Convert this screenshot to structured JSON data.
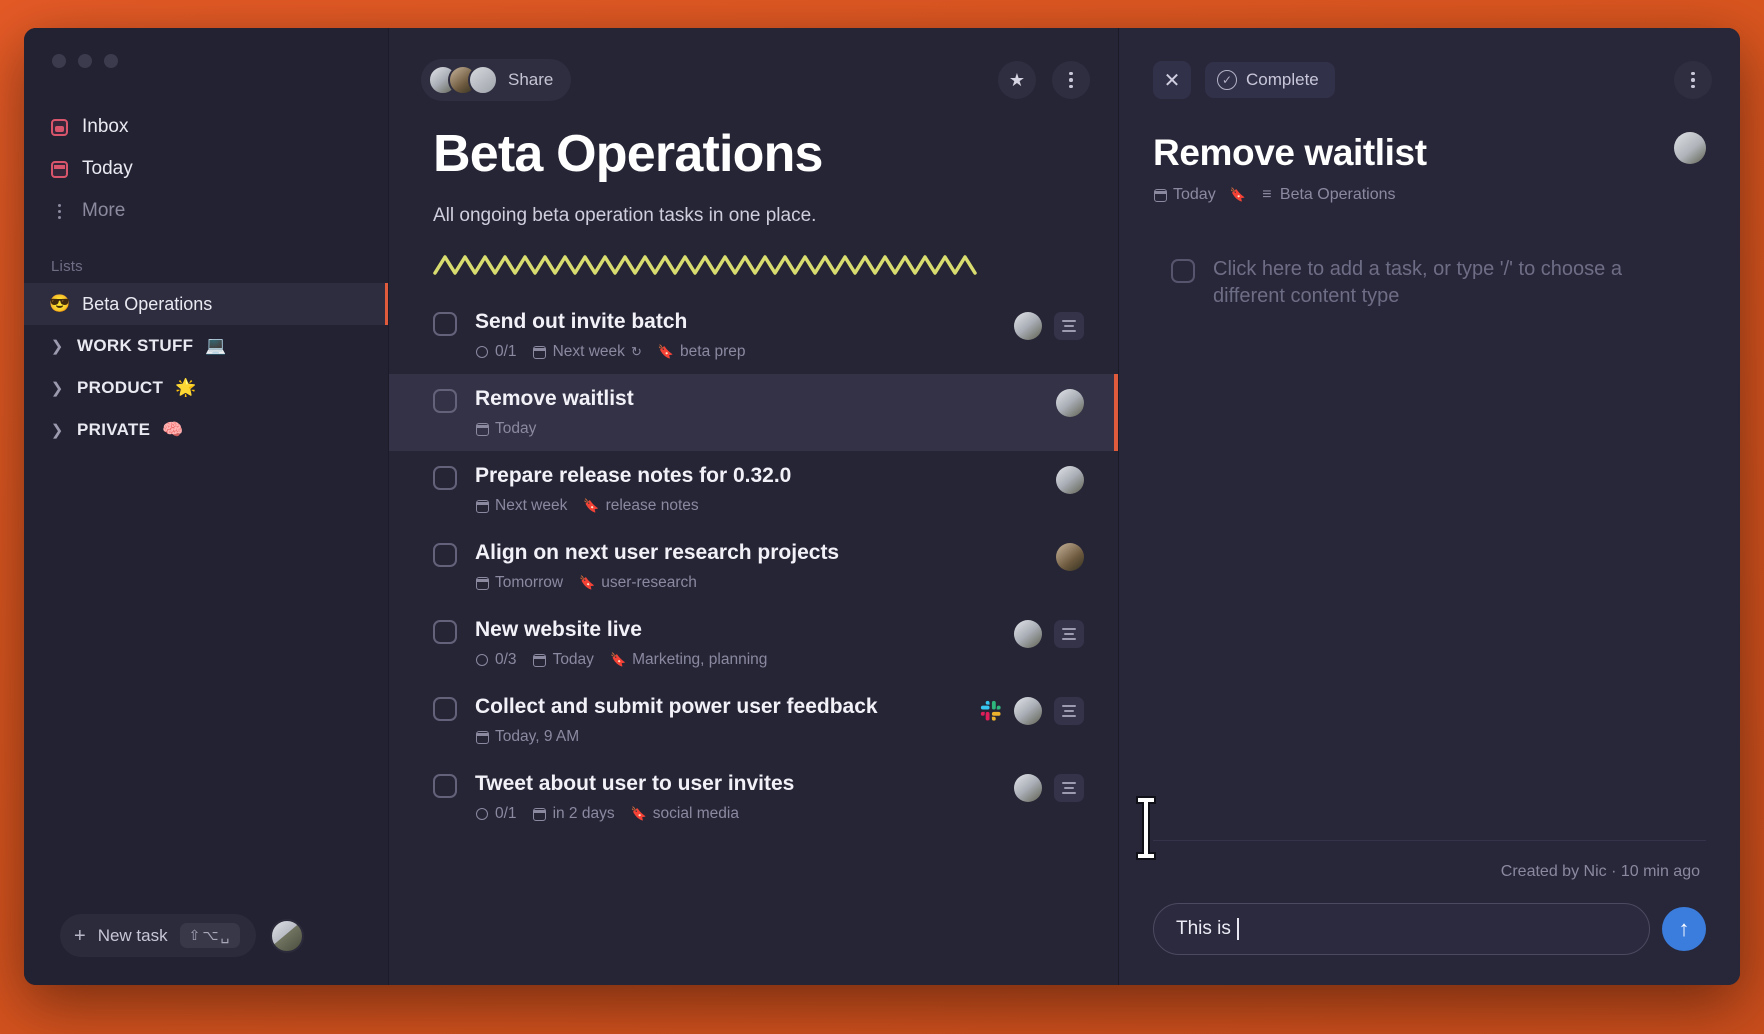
{
  "app": {
    "accent": "#e05a3c",
    "desktop_bg": "#e2592a",
    "window_bg": "#20202e"
  },
  "sidebar": {
    "nav": [
      {
        "label": "Inbox",
        "icon": "inbox-icon"
      },
      {
        "label": "Today",
        "icon": "calendar-icon"
      },
      {
        "label": "More",
        "icon": "more-dots-icon"
      }
    ],
    "section_label": "Lists",
    "lists": [
      {
        "label": "Beta Operations",
        "emoji": "😎",
        "active": true
      },
      {
        "label": "WORK STUFF",
        "emoji": "💻",
        "active": false
      },
      {
        "label": "PRODUCT",
        "emoji": "🌟",
        "active": false
      },
      {
        "label": "PRIVATE",
        "emoji": "🧠",
        "active": false
      }
    ],
    "new_task": {
      "label": "New task",
      "shortcut": "⇧⌥␣"
    }
  },
  "center": {
    "share_label": "Share",
    "star_icon": "star-icon",
    "menu_icon": "more-vertical-icon",
    "title": "Beta Operations",
    "subtitle": "All ongoing beta operation tasks in one place.",
    "squiggle_color": "#d9dd6f",
    "tasks": [
      {
        "title": "Send out invite batch",
        "checked": false,
        "selected": false,
        "subtasks": "0/1",
        "date": "Next week",
        "repeat": true,
        "tags": "beta prep",
        "has_avatar": true,
        "has_notes": true,
        "has_slack": false
      },
      {
        "title": "Remove waitlist",
        "checked": false,
        "selected": true,
        "subtasks": "",
        "date": "Today",
        "repeat": false,
        "tags": "",
        "has_avatar": true,
        "has_notes": false,
        "has_slack": false
      },
      {
        "title": "Prepare release notes for 0.32.0",
        "checked": false,
        "selected": false,
        "subtasks": "",
        "date": "Next week",
        "repeat": false,
        "tags": "release notes",
        "has_avatar": true,
        "has_notes": false,
        "has_slack": false
      },
      {
        "title": "Align on next user research projects",
        "checked": false,
        "selected": false,
        "subtasks": "",
        "date": "Tomorrow",
        "repeat": false,
        "tags": "user-research",
        "has_avatar": true,
        "has_notes": false,
        "has_slack": false
      },
      {
        "title": "New website live",
        "checked": false,
        "selected": false,
        "subtasks": "0/3",
        "date": "Today",
        "repeat": false,
        "tags": "Marketing, planning",
        "has_avatar": true,
        "has_notes": true,
        "has_slack": false
      },
      {
        "title": "Collect and submit power user feedback",
        "checked": false,
        "selected": false,
        "subtasks": "",
        "date": "Today, 9 AM",
        "repeat": false,
        "tags": "",
        "has_avatar": true,
        "has_notes": true,
        "has_slack": true
      },
      {
        "title": "Tweet about user to user invites",
        "checked": false,
        "selected": false,
        "subtasks": "0/1",
        "date": "in 2 days",
        "repeat": false,
        "tags": "social media",
        "has_avatar": true,
        "has_notes": true,
        "has_slack": false
      }
    ]
  },
  "detail": {
    "close_icon": "close-icon",
    "complete_label": "Complete",
    "menu_icon": "more-vertical-icon",
    "title": "Remove waitlist",
    "meta_date": "Today",
    "meta_tag_icon": "tag-icon",
    "meta_list": "Beta Operations",
    "placeholder": "Click here to add a task, or type '/' to choose a different content type",
    "created_by": "Created by Nic · 10 min ago",
    "composer": {
      "value": "This is ",
      "send_icon": "arrow-up-icon",
      "send_color": "#3b7ddd"
    }
  }
}
